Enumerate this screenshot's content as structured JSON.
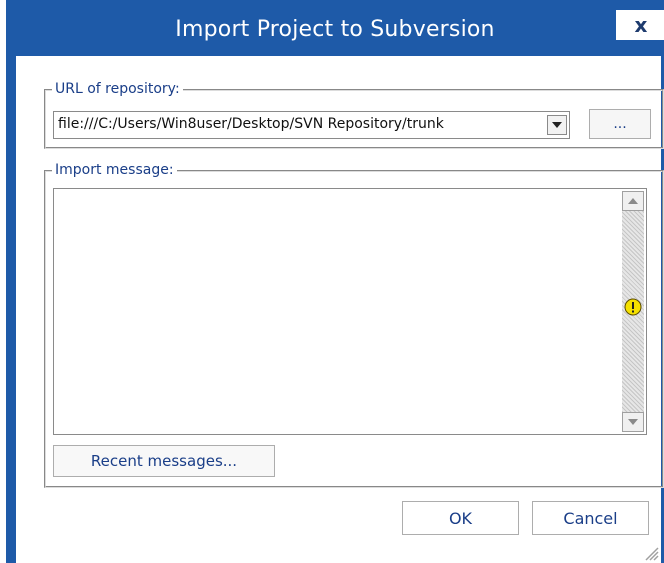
{
  "window": {
    "title": "Import Project to Subversion",
    "close_glyph": "x"
  },
  "url_group": {
    "label": "URL of repository:",
    "value": "file:///C:/Users/Win8user/Desktop/SVN Repository/trunk",
    "browse_label": "..."
  },
  "message_group": {
    "label": "Import message:",
    "value": "",
    "recent_label": "Recent messages..."
  },
  "buttons": {
    "ok": "OK",
    "cancel": "Cancel"
  },
  "colors": {
    "title_bar": "#1e5aa8",
    "label_text": "#1a3e88",
    "warning": "#f5e100"
  },
  "icons": {
    "combo": "chevron-down-icon",
    "scroll_up": "arrow-up-icon",
    "scroll_down": "arrow-down-icon",
    "status": "warning-icon",
    "resize": "resize-grip-icon"
  }
}
